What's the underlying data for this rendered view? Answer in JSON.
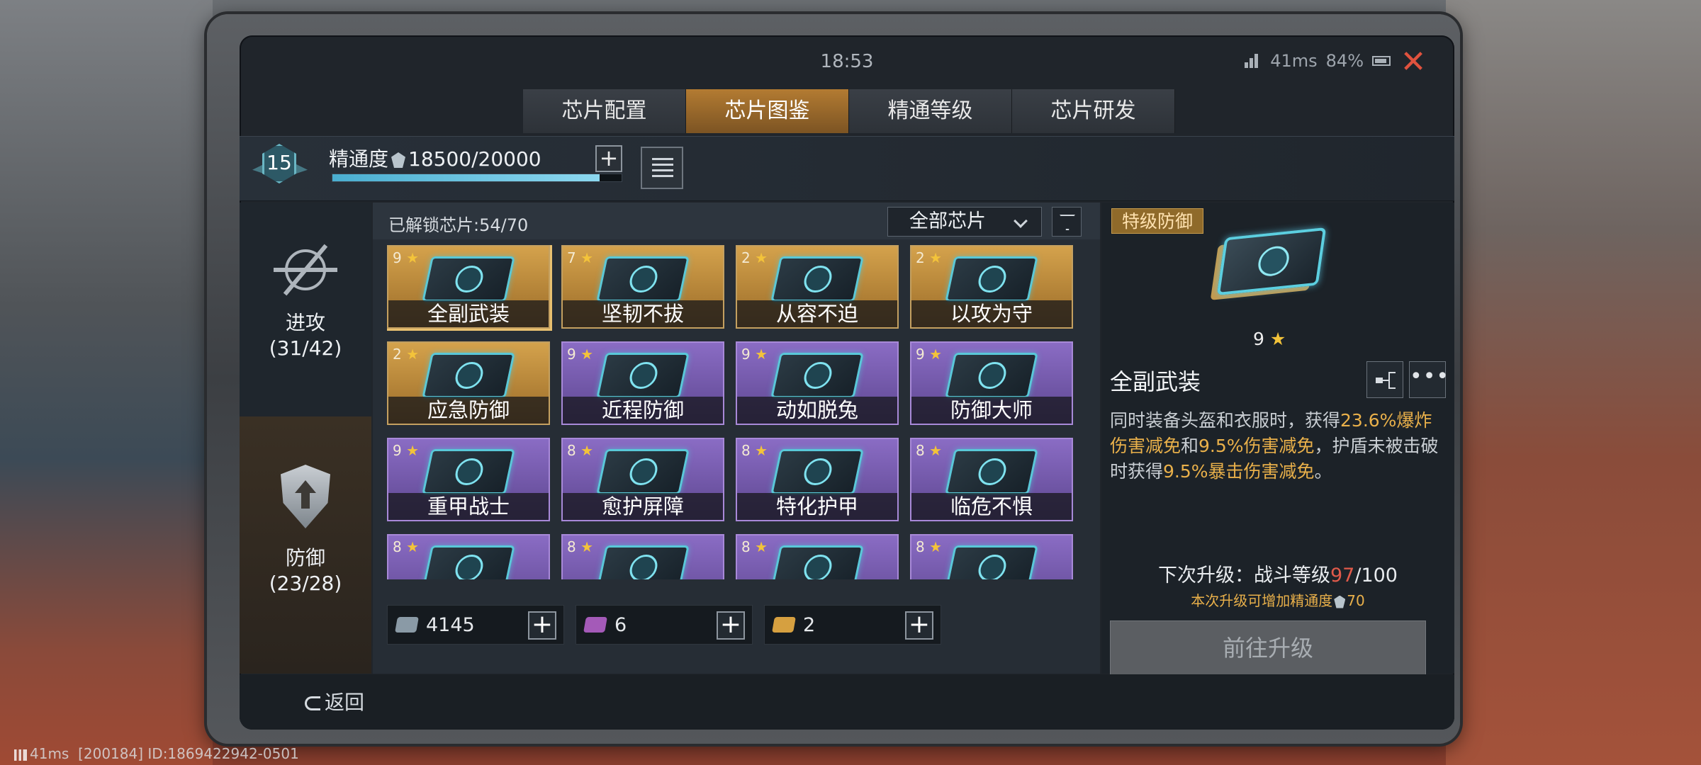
{
  "status": {
    "time": "18:53",
    "ping": "41ms",
    "battery": "84%"
  },
  "tabs": [
    {
      "label": "芯片配置",
      "active": false
    },
    {
      "label": "芯片图鉴",
      "active": true
    },
    {
      "label": "精通等级",
      "active": false
    },
    {
      "label": "芯片研发",
      "active": false
    }
  ],
  "mastery": {
    "level": "15",
    "label": "精通度",
    "value": "18500/20000",
    "progress": 0.925
  },
  "categories": [
    {
      "label": "进攻",
      "count": "(31/42)",
      "icon": "attack-crosshair-icon"
    },
    {
      "label": "防御",
      "count": "(23/28)",
      "icon": "defense-shield-icon"
    }
  ],
  "grid": {
    "unlocked": "已解锁芯片:54/70",
    "filter_label": "全部芯片",
    "cards": [
      {
        "name": "全副武装",
        "stars": "9",
        "tier": "gold"
      },
      {
        "name": "坚韧不拔",
        "stars": "7",
        "tier": "gold"
      },
      {
        "name": "从容不迫",
        "stars": "2",
        "tier": "gold"
      },
      {
        "name": "以攻为守",
        "stars": "2",
        "tier": "gold"
      },
      {
        "name": "应急防御",
        "stars": "2",
        "tier": "gold"
      },
      {
        "name": "近程防御",
        "stars": "9",
        "tier": "purple"
      },
      {
        "name": "动如脱兔",
        "stars": "9",
        "tier": "purple"
      },
      {
        "name": "防御大师",
        "stars": "9",
        "tier": "purple"
      },
      {
        "name": "重甲战士",
        "stars": "9",
        "tier": "purple"
      },
      {
        "name": "愈护屏障",
        "stars": "8",
        "tier": "purple"
      },
      {
        "name": "特化护甲",
        "stars": "8",
        "tier": "purple"
      },
      {
        "name": "临危不惧",
        "stars": "8",
        "tier": "purple"
      },
      {
        "name": "",
        "stars": "8",
        "tier": "purple"
      },
      {
        "name": "",
        "stars": "8",
        "tier": "purple"
      },
      {
        "name": "",
        "stars": "8",
        "tier": "purple"
      },
      {
        "name": "",
        "stars": "8",
        "tier": "purple"
      }
    ],
    "resources": [
      {
        "value": "4145",
        "color": "#8a9aa6"
      },
      {
        "value": "6",
        "color": "#a45ab8"
      },
      {
        "value": "2",
        "color": "#d6a040"
      }
    ]
  },
  "detail": {
    "rank": "特级防御",
    "stars": "9",
    "name": "全副武装",
    "desc_1": "同时装备头盔和衣服时，获得",
    "desc_hl_1": "23.6%爆炸伤害减免",
    "desc_2": "和",
    "desc_hl_2": "9.5%伤害减免",
    "desc_3": "，护盾未被击破时获得",
    "desc_hl_3": "9.5%暴击伤害减免",
    "desc_4": "。",
    "next_label": "下次升级：战斗等级",
    "next_current": "97",
    "next_sep": "/",
    "next_total": "100",
    "gain_label": "本次升级可增加精通度",
    "gain_value": "70",
    "upgrade_button": "前往升级"
  },
  "footer": {
    "back": "返回"
  },
  "system": {
    "ping": "41ms",
    "id": "[200184] ID:1869422942-0501"
  }
}
